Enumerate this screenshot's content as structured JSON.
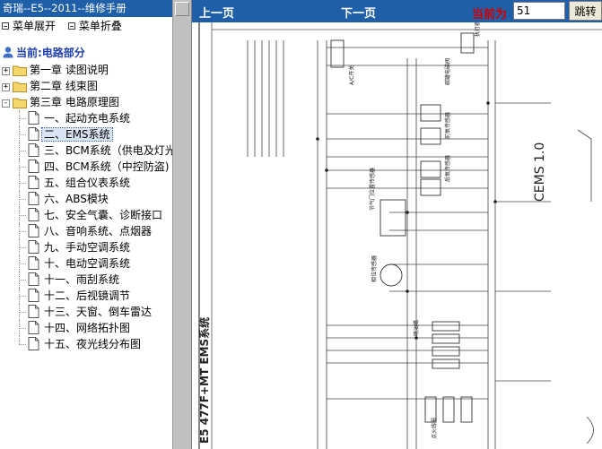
{
  "left_pane": {
    "title": "奇瑞--E5--2011--维修手册",
    "toolbar": {
      "expand": "菜单展开",
      "collapse": "菜单折叠"
    },
    "current_section": "当前:电路部分",
    "chapters": [
      {
        "label": "第一章  读图说明",
        "toggle": "+"
      },
      {
        "label": "第二章  线束图",
        "toggle": "+"
      },
      {
        "label": "第三章  电路原理图",
        "toggle": "-"
      }
    ],
    "items": [
      "一、起动充电系统",
      "二、EMS系统",
      "三、BCM系统（供电及灯光",
      "四、BCM系统（中控防盗)",
      "五、组合仪表系统",
      "六、ABS模块",
      "七、安全气囊、诊断接口",
      "八、音响系统、点烟器",
      "九、手动空调系统",
      "十、电动空调系统",
      "十一、雨刮系统",
      "十二、后视镜调节",
      "十三、天窗、倒车雷达",
      "十四、网络拓扑图",
      "十五、夜光线分布图"
    ],
    "selected_index": 1
  },
  "top_bar": {
    "prev": "上一页",
    "next": "下一页",
    "current_label": "当前为",
    "page_value": "51",
    "jump": "跳转"
  },
  "diagram": {
    "title": "E5 477F+MT EMS系统",
    "side_label": "CEMS 1.0",
    "components": [
      "A/C开关",
      "碳罐电磁阀",
      "前氧传感器",
      "后氧传感器",
      "节气门位置传感器",
      "相位传感器",
      "喷油嘴",
      "点火线圈",
      "执行器"
    ]
  },
  "colors": {
    "title_bar": "#1f5fa8",
    "current_label": "#cc0000",
    "current_section": "#1f3fae"
  }
}
